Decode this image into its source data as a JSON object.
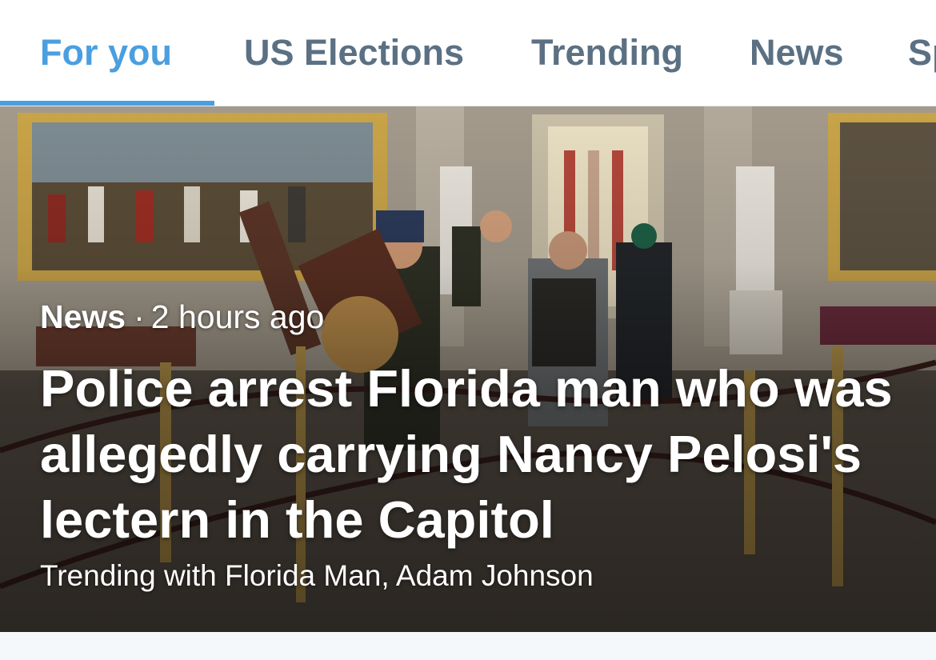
{
  "tabs": [
    {
      "label": "For you",
      "active": true
    },
    {
      "label": "US Elections",
      "active": false
    },
    {
      "label": "Trending",
      "active": false
    },
    {
      "label": "News",
      "active": false
    },
    {
      "label": "Sp",
      "active": false
    }
  ],
  "colors": {
    "accent": "#4a9fe0",
    "tab_inactive": "#5b7083",
    "card_text": "#ffffff"
  },
  "hero": {
    "category": "News",
    "separator": "·",
    "time_ago": "2 hours ago",
    "headline": "Police arrest Florida man who was allegedly carrying Nancy Pelosi's lectern in the Capitol",
    "trending": "Trending with Florida Man, Adam Johnson",
    "image": "photo-capitol-rotunda"
  }
}
